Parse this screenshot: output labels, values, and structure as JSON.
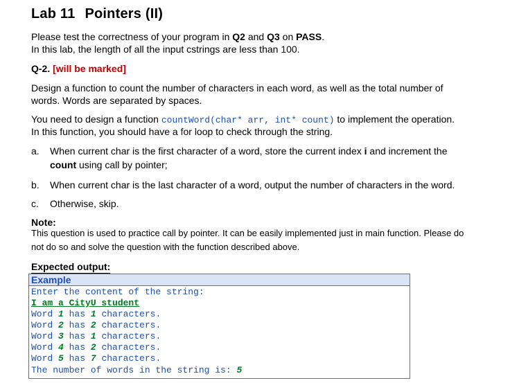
{
  "title": {
    "lab": "Lab 11",
    "name": "Pointers (II)"
  },
  "intro": {
    "line1_a": "Please test the correctness of your program in ",
    "q2": "Q2",
    "line1_b": " and ",
    "q3": "Q3",
    "line1_c": " on ",
    "pass": "PASS",
    "line1_d": ".",
    "line2": "In this lab, the length of all the input cstrings are less than 100."
  },
  "question": {
    "id": "Q-2.",
    "mark": "[will be marked]"
  },
  "desc": {
    "line1": "Design a function to count the number of characters in each word, as well as the total number of",
    "line2": "words. Words are separated by spaces.",
    "line3_a": "You need to design a function ",
    "line3_code": "countWord(char* arr, int* count)",
    "line3_b": " to implement the operation.",
    "line4": "In this function, you should have a for loop to check through the string."
  },
  "list": [
    {
      "marker": "a.",
      "line1_a": "When current char is the first character of a word, store the current index ",
      "bold_i": "i",
      "line1_b": " and increment the",
      "bold_count": "count",
      "line2_b": " using call by pointer;"
    },
    {
      "marker": "b.",
      "text": "When current char is the last character of a word, output the number of characters in the word."
    },
    {
      "marker": "c.",
      "text": "Otherwise, skip."
    }
  ],
  "note": {
    "heading": "Note:",
    "line1": "This question is used to practice call by pointer. It can be easily implemented just in main function. Please do",
    "line2": "not do so and solve the question with the function described above."
  },
  "expected": {
    "heading": "Expected output:",
    "box_title": "Example",
    "prompt": "Enter the content of the string:",
    "input": "I am a CityU student",
    "words": [
      {
        "prefix": "Word ",
        "n": "1",
        "mid": " has ",
        "c": "1",
        "suffix": " characters."
      },
      {
        "prefix": "Word ",
        "n": "2",
        "mid": " has ",
        "c": "2",
        "suffix": " characters."
      },
      {
        "prefix": "Word ",
        "n": "3",
        "mid": " has ",
        "c": "1",
        "suffix": " characters."
      },
      {
        "prefix": "Word ",
        "n": "4",
        "mid": " has ",
        "c": "2",
        "suffix": " characters."
      },
      {
        "prefix": "Word ",
        "n": "5",
        "mid": " has ",
        "c": "7",
        "suffix": " characters."
      }
    ],
    "total_label": "The number of words in the string is: ",
    "total_value": "5"
  }
}
